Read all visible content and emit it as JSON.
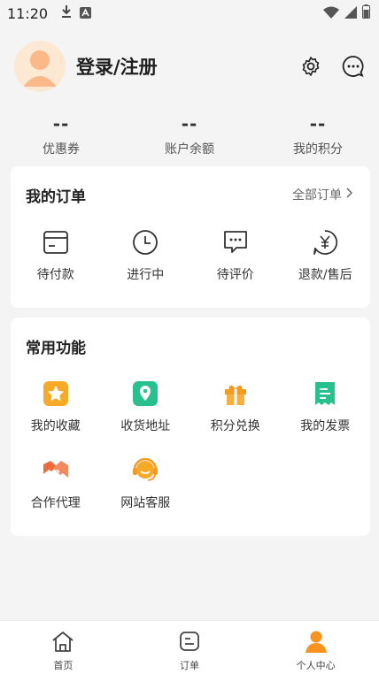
{
  "status_bar": {
    "time": "11:20"
  },
  "profile": {
    "login_label": "登录/注册"
  },
  "stats": [
    {
      "value": "--",
      "label": "优惠券"
    },
    {
      "value": "--",
      "label": "账户余额"
    },
    {
      "value": "--",
      "label": "我的积分"
    }
  ],
  "orders": {
    "title": "我的订单",
    "all_link": "全部订单",
    "items": [
      {
        "label": "待付款",
        "icon": "wallet-icon"
      },
      {
        "label": "进行中",
        "icon": "clock-icon"
      },
      {
        "label": "待评价",
        "icon": "comment-icon"
      },
      {
        "label": "退款/售后",
        "icon": "refund-icon"
      }
    ]
  },
  "functions": {
    "title": "常用功能",
    "items": [
      {
        "label": "我的收藏",
        "icon": "star-icon",
        "color": "#f7a928"
      },
      {
        "label": "收货地址",
        "icon": "location-icon",
        "color": "#28c08d"
      },
      {
        "label": "积分兑换",
        "icon": "gift-icon",
        "color": "#f59a23"
      },
      {
        "label": "我的发票",
        "icon": "invoice-icon",
        "color": "#28c08d"
      },
      {
        "label": "合作代理",
        "icon": "handshake-icon",
        "color": "#f06a3a"
      },
      {
        "label": "网站客服",
        "icon": "customer-service-icon",
        "color": "#f7a928"
      }
    ]
  },
  "tabbar": [
    {
      "label": "首页",
      "icon": "home-icon",
      "active": false
    },
    {
      "label": "订单",
      "icon": "order-icon",
      "active": false
    },
    {
      "label": "个人中心",
      "icon": "user-icon",
      "active": true
    }
  ],
  "colors": {
    "accent": "#f7931e",
    "avatar_bg": "#fde8d4"
  }
}
